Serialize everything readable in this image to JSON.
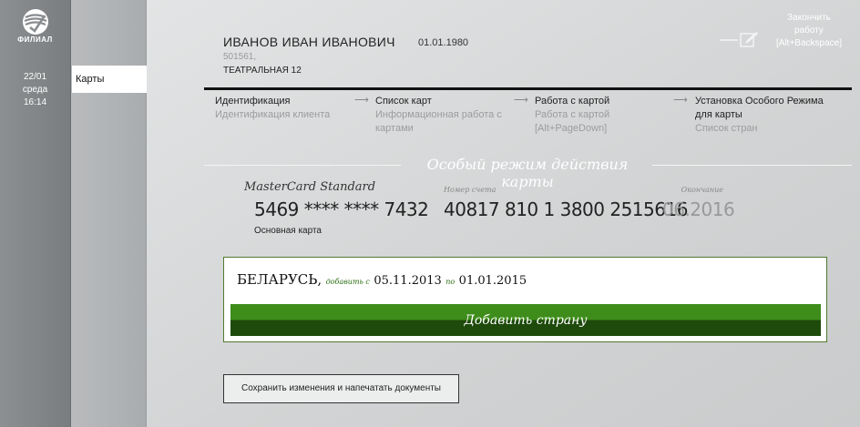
{
  "rail": {
    "branch": "ФИЛИАЛ",
    "date": "22/01",
    "weekday": "среда",
    "time": "16:14",
    "logo_icon": "sberbank-logo-icon"
  },
  "nav": {
    "items": [
      {
        "label": "Карты",
        "active": true
      }
    ]
  },
  "client": {
    "name": "ИВАНОВ ИВАН ИВАНОВИЧ",
    "dob": "01.01.1980",
    "code": "501561,",
    "address": "ТЕАТРАЛЬНАЯ 12"
  },
  "finish": {
    "line1": "Закончить",
    "line2": "работу",
    "line3": "[Alt+Backspace]",
    "icon": "edit-icon"
  },
  "steps": [
    {
      "title": "Идентификация",
      "sub": "Идентификация клиента"
    },
    {
      "title": "Список карт",
      "sub": "Информационная работа с картами"
    },
    {
      "title": "Работа с картой",
      "sub": "Работа с картой [Alt+PageDown]"
    },
    {
      "title": "Установка Особого Режима для карты",
      "sub": "Список стран"
    }
  ],
  "section_title": "Особый режим действия карты",
  "card": {
    "type": "MasterCard Standard",
    "number": "5469 **** **** 7432",
    "label": "Основная карта",
    "account_label": "Номер счета",
    "account_number": "40817 810 1 3800 2515616",
    "expiry_label": "Окончание",
    "expiry": "06.2016"
  },
  "country": {
    "name": "БЕЛАРУСЬ,",
    "add_from_label": "добавить с",
    "from": "05.11.2013",
    "to_label": "по",
    "to": "01.01.2015",
    "add_button": "Добавить страну"
  },
  "save_button": "Сохранить изменения и напечатать документы",
  "colors": {
    "accent_green": "#3e8c1a",
    "accent_green_dark": "#1e4a0c",
    "rail_gray": "#8c8f91",
    "active_nav": "#ffffff"
  }
}
